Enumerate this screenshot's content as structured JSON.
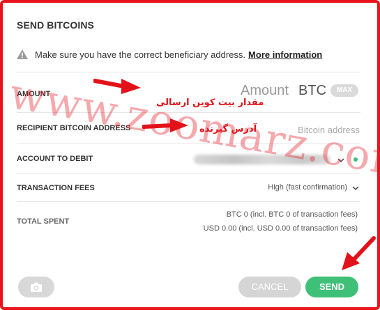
{
  "dialog": {
    "title": "SEND BITCOINS",
    "notice": {
      "text": "Make sure you have the correct beneficiary address.",
      "link": "More information"
    }
  },
  "fields": {
    "amount": {
      "label": "AMOUNT",
      "placeholder": "Amount",
      "unit": "BTC",
      "max_label": "MAX"
    },
    "recipient": {
      "label": "RECIPIENT BITCOIN ADDRESS",
      "placeholder": "Bitcoin address",
      "value": ""
    },
    "account": {
      "label": "ACCOUNT TO DEBIT"
    },
    "fees": {
      "label": "TRANSACTION FEES",
      "value": "High (fast confirmation)"
    },
    "total": {
      "label": "TOTAL SPENT",
      "btc_line": "BTC 0 (incl. BTC 0 of transaction fees)",
      "usd_line": "USD 0.00 (incl. USD 0.00 of transaction fees)"
    }
  },
  "buttons": {
    "cancel": "CANCEL",
    "send": "SEND"
  },
  "annotations": {
    "amount_note": "مقدار بیت کوین ارسالی",
    "address_note": "آدرس گیرنده",
    "watermark": "www.zoomarz.com"
  },
  "colors": {
    "accent": "#3fc078",
    "annotation": "#e3121a",
    "border": "#e8141b"
  },
  "icons": [
    "warning-icon",
    "camera-icon",
    "chevron-down-icon",
    "status-dot-icon"
  ]
}
